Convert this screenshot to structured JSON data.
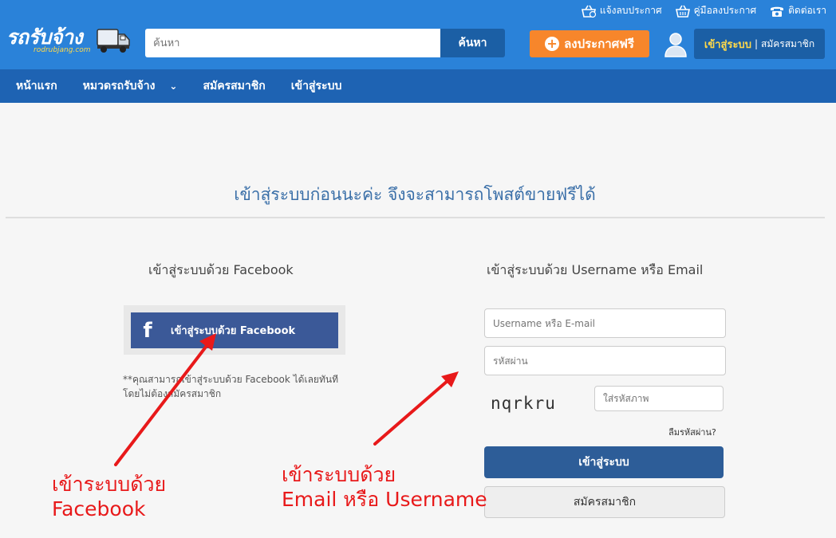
{
  "header": {
    "top_links": [
      {
        "label": "แจ้งลบประกาศ",
        "icon": "basket-remove-icon"
      },
      {
        "label": "คู่มือลงประกาศ",
        "icon": "basket-icon"
      },
      {
        "label": "ติดต่อเรา",
        "icon": "phone-icon"
      }
    ],
    "logo_text": "รถรับจ้าง",
    "logo_sub": "rodrubjang.com",
    "search_placeholder": "ค้นหา",
    "search_button": "ค้นหา",
    "post_button": "ลงประกาศฟรี",
    "login_link": "เข้าสู่ระบบ",
    "separator": "|",
    "register_link": "สมัครสมาชิก"
  },
  "nav": {
    "items": [
      {
        "label": "หน้าแรก"
      },
      {
        "label": "หมวดรถรับจ้าง",
        "chevron": "⌄"
      },
      {
        "label": "สมัครสมาชิก"
      },
      {
        "label": "เข้าสู่ระบบ"
      }
    ]
  },
  "main": {
    "title": "เข้าสู่ระบบก่อนนะค่ะ จึงจะสามารถโพสต์ขายฟรีได้",
    "facebook": {
      "heading": "เข้าสู่ระบบด้วย Facebook",
      "button_icon": "f",
      "button_label": "เข้าสู่ระบบด้วย Facebook",
      "note": "**คุณสามารถเข้าสู่ระบบด้วย Facebook ได้เลยทันที โดยไม่ต้องสมัครสมาชิก"
    },
    "credentials": {
      "heading": "เข้าสู่ระบบด้วย Username หรือ Email",
      "username_placeholder": "Username หรือ E-mail",
      "password_placeholder": "รหัสผ่าน",
      "captcha_text": "nqrkru",
      "captcha_placeholder": "ใส่รหัสภาพ",
      "forgot": "ลืมรหัสผ่าน?",
      "submit": "เข้าสู่ระบบ",
      "register": "สมัครสมาชิก"
    }
  },
  "annotations": {
    "facebook_line1": "เข้าระบบด้วย",
    "facebook_line2": "Facebook",
    "email_line1": "เข้าระบบด้วย",
    "email_line2": "Email หรือ Username",
    "color": "#e8191a"
  },
  "colors": {
    "header_blue": "#2a82d9",
    "nav_blue": "#1e63b3",
    "orange": "#f7862b",
    "facebook_blue": "#3b5998",
    "submit_blue": "#2d5d98",
    "title_blue": "#3a6fa8",
    "login_yellow": "#ffd94a"
  }
}
